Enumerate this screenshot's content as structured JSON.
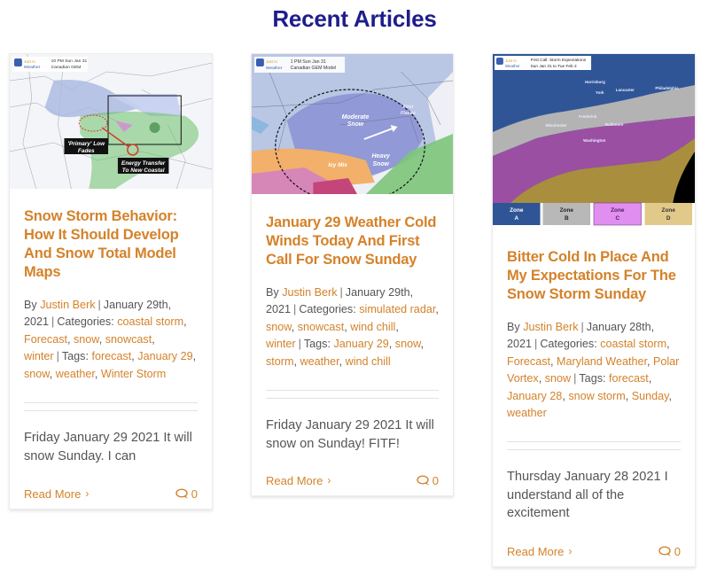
{
  "section": {
    "title": "Recent Articles"
  },
  "colors": {
    "title": "#1f1d8c",
    "accent": "#d4822a",
    "text": "#555555"
  },
  "articles": [
    {
      "image": {
        "logo_text": [
          "Just In",
          "Weather"
        ],
        "caption": [
          "10 PM Sun Jan 31",
          "Canadian GEM"
        ],
        "labels": [
          "'Primary' Low",
          "Fades",
          "Energy Transfer",
          "To New Coastal"
        ]
      },
      "title": "Snow Storm Behavior: How It Should Develop And Snow Total Model Maps",
      "meta": {
        "by": "By",
        "author": "Justin Berk",
        "date": "January 29th, 2021",
        "categories_label": "Categories:",
        "categories": [
          "coastal storm",
          "Forecast",
          "snow",
          "snowcast",
          "winter"
        ],
        "tags_label": "Tags:",
        "tags": [
          "forecast",
          "January 29",
          "snow",
          "weather",
          "Winter Storm"
        ]
      },
      "excerpt": "Friday January 29 2021 It will snow Sunday. I can",
      "read_more": "Read More",
      "comment_count": "0"
    },
    {
      "image": {
        "logo_text": [
          "Just In",
          "Weather"
        ],
        "caption": [
          "1 PM Sun Jan 31",
          "Canadian GEM Model"
        ],
        "labels": [
          "Moderate",
          "Snow",
          "Heavy",
          "Snow",
          "Icy Mix",
          "First",
          "Flakes"
        ]
      },
      "title": "January 29 Weather Cold Winds Today And First Call For Snow Sunday",
      "meta": {
        "by": "By",
        "author": "Justin Berk",
        "date": "January 29th, 2021",
        "categories_label": "Categories:",
        "categories": [
          "simulated radar",
          "snow",
          "snowcast",
          "wind chill",
          "winter"
        ],
        "tags_label": "Tags:",
        "tags": [
          "January 29",
          "snow",
          "storm",
          "weather",
          "wind chill"
        ]
      },
      "excerpt": "Friday January 29 2021 It will snow on Sunday! FITF!",
      "read_more": "Read More",
      "comment_count": "0"
    },
    {
      "image": {
        "logo_text": [
          "Just In",
          "Weather"
        ],
        "caption": [
          "First Call: Storm Expectations",
          "Sun Jan 31 to Tue Feb 2"
        ],
        "cities": [
          "Harrisburg",
          "Lancaster",
          "York",
          "Philadelphia",
          "Baltimore",
          "Winchester",
          "Washington",
          "Frederick"
        ],
        "zones": [
          {
            "label": "Zone",
            "letter": "A",
            "color": "#2f5597"
          },
          {
            "label": "Zone",
            "letter": "B",
            "color": "#b8b8b8"
          },
          {
            "label": "Zone",
            "letter": "C",
            "color": "#e08ef0"
          },
          {
            "label": "Zone",
            "letter": "D",
            "color": "#e1c98a"
          }
        ]
      },
      "title": "Bitter Cold In Place And My Expectations For The Snow Storm Sunday",
      "meta": {
        "by": "By",
        "author": "Justin Berk",
        "date": "January 28th, 2021",
        "categories_label": "Categories:",
        "categories": [
          "coastal storm",
          "Forecast",
          "Maryland Weather",
          "Polar Vortex",
          "snow"
        ],
        "tags_label": "Tags:",
        "tags": [
          "forecast",
          "January 28",
          "snow storm",
          "Sunday",
          "weather"
        ]
      },
      "excerpt": "Thursday January 28 2021 I understand all of the excitement",
      "read_more": "Read More",
      "comment_count": "0"
    }
  ]
}
